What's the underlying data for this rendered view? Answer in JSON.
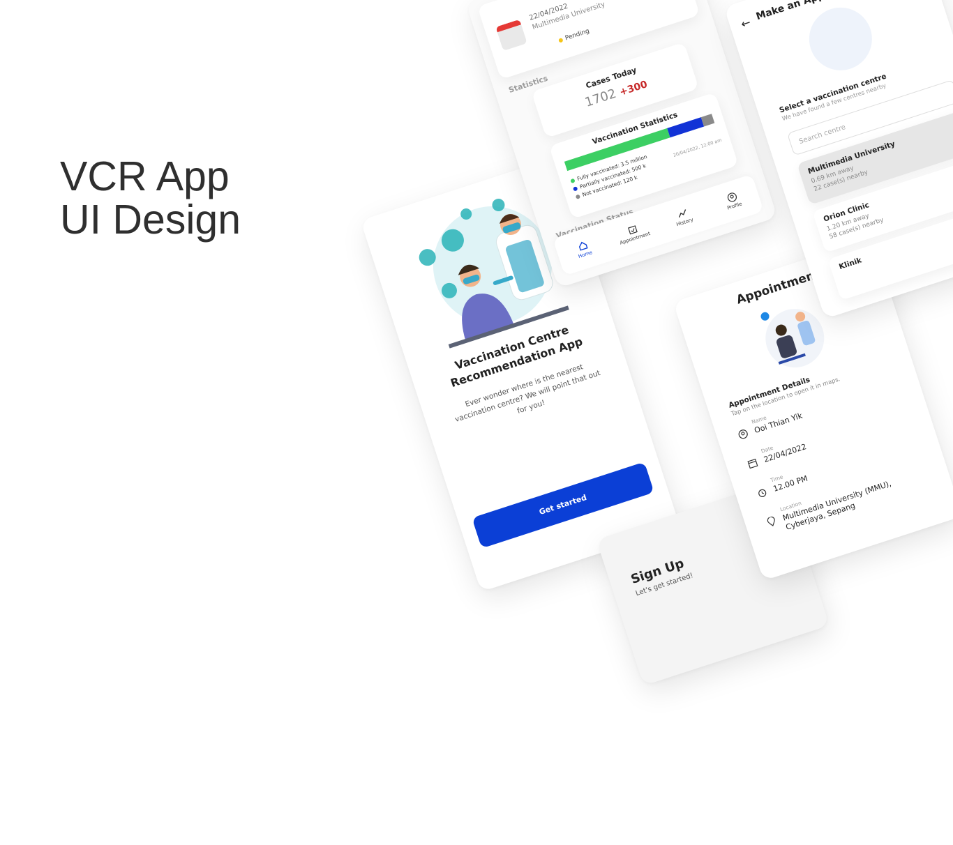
{
  "hero": {
    "line1": "VCR App",
    "line2": "UI Design"
  },
  "welcome": {
    "title_line1": "Vaccination Centre",
    "title_line2": "Recommendation App",
    "description": "Ever wonder where is the nearest vaccination centre? We will point that out for you!",
    "cta": "Get started"
  },
  "signup": {
    "title": "Sign Up",
    "subtitle": "Let's get started!"
  },
  "home": {
    "upcoming": {
      "date": "22/04/2022",
      "location": "Multimedia University",
      "status": "Pending",
      "status_color": "#f5c518"
    },
    "statistics_label": "Statistics",
    "cases": {
      "title": "Cases Today",
      "value": "1702",
      "delta": "+300"
    },
    "vaccination": {
      "title": "Vaccination Statistics",
      "fully": "Fully vaccinated: 3.5 million",
      "partially": "Partially vaccinated: 500 k",
      "not": "Not vaccinated: 120 k",
      "timestamp": "20/04/2022, 12:00 am",
      "shares": {
        "fully": 0.7,
        "partially": 0.23,
        "not": 0.07
      },
      "colors": {
        "fully": "#3ccf63",
        "partially": "#1233d6",
        "not": "#8a8a8a"
      }
    },
    "status_label": "Vaccination Status",
    "nav": {
      "home": "Home",
      "appointment": "Appointment",
      "history": "History",
      "profile": "Profile"
    }
  },
  "appointment": {
    "title": "Appointment",
    "details_title": "Appointment Details",
    "details_sub": "Tap on the location to open it in maps.",
    "name_label": "Name",
    "name": "Ooi Thian Yik",
    "date_label": "Date",
    "date": "22/04/2022",
    "time_label": "Time",
    "time": "12.00 PM",
    "location_label": "Location",
    "location": "Multimedia University (MMU), Cyberjaya, Sepang"
  },
  "make": {
    "title": "Make an Appointment",
    "select_title": "Select a vaccination centre",
    "select_sub": "We have found a few centres nearby",
    "search_placeholder": "Search centre",
    "centres": [
      {
        "name": "Multimedia University",
        "distance": "0.69 km away",
        "cases": "22 case(s) nearby"
      },
      {
        "name": "Orion Clinic",
        "distance": "1.20 km away",
        "cases": "58 case(s) nearby"
      },
      {
        "name": "Klinik",
        "distance": "",
        "cases": ""
      }
    ]
  },
  "brand": {
    "primary": "#0b3fd6"
  }
}
